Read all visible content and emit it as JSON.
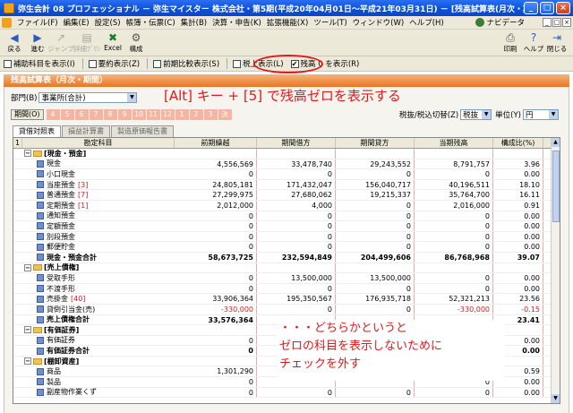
{
  "window": {
    "title": "弥生会計 08 プロフェッショナル － 弥生マイスター 株式会社・第5期(平成20年04月01日～平成21年03月31日) － [残高試算表(月次・期間)]",
    "buttons": [
      "_",
      "□",
      "×"
    ]
  },
  "menu": {
    "items": [
      "ファイル(F)",
      "編集(E)",
      "設定(S)",
      "帳簿・伝票(C)",
      "集計(B)",
      "決算・申告(K)",
      "拡張機能(X)",
      "ツール(T)",
      "ウィンドウ(W)",
      "ヘルプ(H)"
    ],
    "navi_label": "ナビデータ",
    "mdi_buttons": [
      "_",
      "□",
      "×"
    ]
  },
  "toolbar": {
    "back_label": "戻る",
    "forward_label": "進む",
    "jump_label": "ジャンプ",
    "detail_label": "詳細ﾌﾟﾘﾝ",
    "excel_label": "Excel",
    "structure_label": "構成",
    "print_label": "印刷",
    "help_label": "ヘルプ",
    "close_label": "閉じる"
  },
  "options": {
    "items": [
      {
        "label": "補助科目を表示(I)",
        "checked": false
      },
      {
        "label": "要約表示(Z)",
        "checked": false
      },
      {
        "label": "前期比較表示(S)",
        "checked": false
      },
      {
        "label": "税上表示(L)",
        "checked": false
      },
      {
        "label": "残高 0 を表示(R)",
        "checked": true
      }
    ]
  },
  "panel": {
    "title": "残高試算表（月次・期間）",
    "dept_label": "部門(B)",
    "dept_value": "事業所(合計)",
    "period_button": "期間(O)",
    "months": [
      "4",
      "5",
      "6",
      "7",
      "8",
      "9",
      "10",
      "11",
      "12",
      "1",
      "2",
      "3",
      "決"
    ],
    "tax_label": "税抜/税込切替(Z)",
    "tax_value": "税抜",
    "unit_label": "単位(Y)",
    "unit_value": "円",
    "tabs": [
      "貸借対照表",
      "損益計算書",
      "製造原価報告書"
    ]
  },
  "annotations": {
    "top": "[Alt] キー + [5] で残高ゼロを表示する",
    "bottom_line1": "・・・どちらかというと",
    "bottom_line2": "ゼロの科目を表示しないために",
    "bottom_line3": "チェックを外す"
  },
  "table": {
    "headers": [
      "1",
      "勘定科目",
      "前期繰越",
      "期間借方",
      "期間貸方",
      "当期残高",
      "構成比(%)"
    ],
    "rows": [
      {
        "type": "group",
        "name": "[現金・預金]",
        "vals": [
          "",
          "",
          "",
          "",
          ""
        ]
      },
      {
        "type": "acct",
        "name": "現金",
        "code": "",
        "vals": [
          "4,556,569",
          "33,478,740",
          "29,243,552",
          "8,791,757",
          "3.96"
        ]
      },
      {
        "type": "acct",
        "name": "小口現金",
        "code": "",
        "vals": [
          "0",
          "0",
          "0",
          "0",
          "0.00"
        ]
      },
      {
        "type": "acct",
        "name": "当座預金",
        "code": "[3]",
        "vals": [
          "24,805,181",
          "171,432,047",
          "156,040,717",
          "40,196,511",
          "18.10"
        ]
      },
      {
        "type": "acct",
        "name": "普通預金",
        "code": "[7]",
        "vals": [
          "27,299,975",
          "27,680,062",
          "19,215,337",
          "35,764,700",
          "16.11"
        ]
      },
      {
        "type": "acct",
        "name": "定期預金",
        "code": "[1]",
        "vals": [
          "2,012,000",
          "4,000",
          "0",
          "2,016,000",
          "0.91"
        ]
      },
      {
        "type": "acct",
        "name": "通知預金",
        "code": "",
        "vals": [
          "0",
          "0",
          "0",
          "0",
          "0.00"
        ]
      },
      {
        "type": "acct",
        "name": "定額預金",
        "code": "",
        "vals": [
          "0",
          "0",
          "0",
          "0",
          "0.00"
        ]
      },
      {
        "type": "acct",
        "name": "別段預金",
        "code": "",
        "vals": [
          "0",
          "0",
          "0",
          "0",
          "0.00"
        ]
      },
      {
        "type": "acct",
        "name": "郵便貯金",
        "code": "",
        "vals": [
          "0",
          "0",
          "0",
          "0",
          "0.00"
        ]
      },
      {
        "type": "total",
        "name": "現金・預金合計",
        "vals": [
          "58,673,725",
          "232,594,849",
          "204,499,606",
          "86,768,968",
          "39.07"
        ]
      },
      {
        "type": "group",
        "name": "[売上債権]",
        "vals": [
          "",
          "",
          "",
          "",
          ""
        ]
      },
      {
        "type": "acct",
        "name": "受取手形",
        "code": "",
        "vals": [
          "0",
          "13,500,000",
          "13,500,000",
          "0",
          "0.00"
        ]
      },
      {
        "type": "acct",
        "name": "不渡手形",
        "code": "",
        "vals": [
          "0",
          "0",
          "0",
          "0",
          "0.00"
        ]
      },
      {
        "type": "acct",
        "name": "売掛金",
        "code": "[40]",
        "vals": [
          "33,906,364",
          "195,350,567",
          "176,935,718",
          "52,321,213",
          "23.56"
        ]
      },
      {
        "type": "acct",
        "name": "貸倒引当金(売)",
        "code": "",
        "vals": [
          "-330,000",
          "0",
          "0",
          "-330,000",
          "-0.15"
        ]
      },
      {
        "type": "total",
        "name": "売上債権合計",
        "vals": [
          "33,576,364",
          "",
          "",
          "",
          "23.41"
        ]
      },
      {
        "type": "group",
        "name": "[有価証券]",
        "vals": [
          "",
          "",
          "",
          "",
          ""
        ]
      },
      {
        "type": "acct",
        "name": "有価証券",
        "code": "",
        "vals": [
          "0",
          "",
          "",
          "0",
          "0.00"
        ]
      },
      {
        "type": "total",
        "name": "有価証券合計",
        "vals": [
          "0",
          "",
          "",
          "0",
          "0.00"
        ]
      },
      {
        "type": "group",
        "name": "[棚卸資産]",
        "vals": [
          "",
          "",
          "",
          "",
          ""
        ]
      },
      {
        "type": "acct",
        "name": "商品",
        "code": "",
        "vals": [
          "1,301,290",
          "",
          "",
          "0",
          "0.59"
        ]
      },
      {
        "type": "acct",
        "name": "製品",
        "code": "",
        "vals": [
          "0",
          "",
          "",
          "0",
          "0.00"
        ]
      },
      {
        "type": "acct",
        "name": "副産物作業くず",
        "code": "",
        "vals": [
          "0",
          "0",
          "0",
          "0",
          "0.00"
        ]
      }
    ]
  }
}
